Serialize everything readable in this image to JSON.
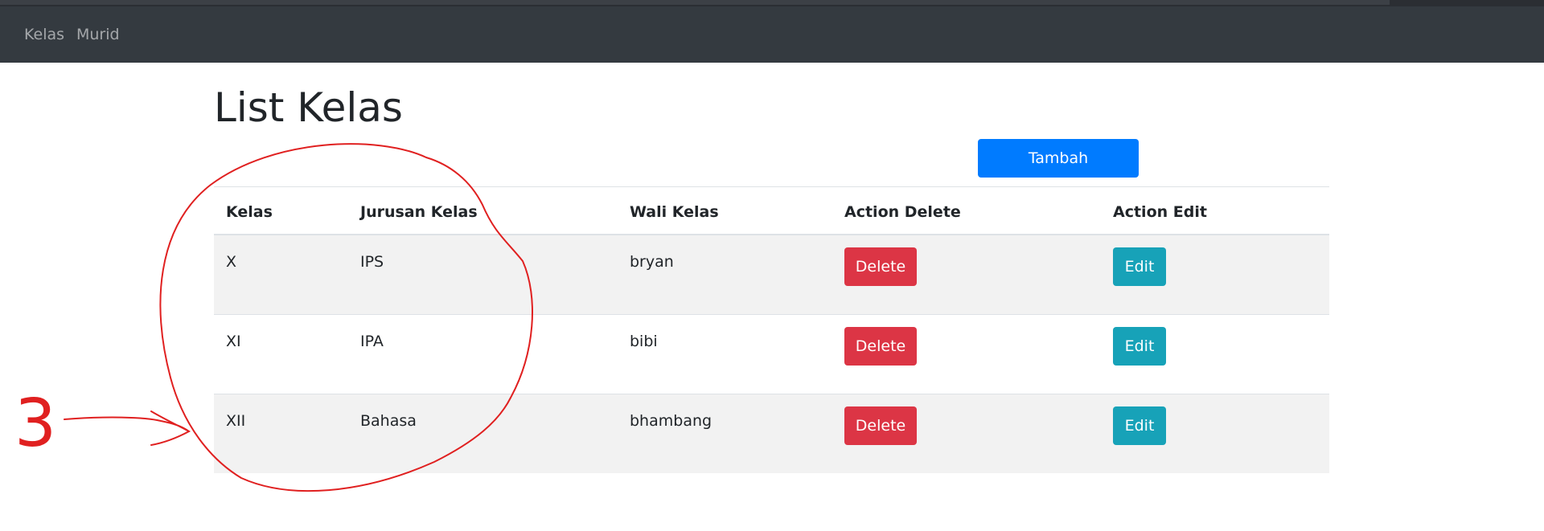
{
  "nav": {
    "items": [
      {
        "label": "Kelas"
      },
      {
        "label": "Murid"
      }
    ]
  },
  "page": {
    "title": "List Kelas",
    "add_button": "Tambah"
  },
  "table": {
    "headers": [
      "Kelas",
      "Jurusan Kelas",
      "Wali Kelas",
      "Action Delete",
      "Action Edit"
    ],
    "rows": [
      {
        "kelas": "X",
        "jurusan": "IPS",
        "wali": "bryan",
        "delete_label": "Delete",
        "edit_label": "Edit"
      },
      {
        "kelas": "XI",
        "jurusan": "IPA",
        "wali": "bibi",
        "delete_label": "Delete",
        "edit_label": "Edit"
      },
      {
        "kelas": "XII",
        "jurusan": "Bahasa",
        "wali": "bhambang",
        "delete_label": "Delete",
        "edit_label": "Edit"
      }
    ]
  },
  "annotation": {
    "number": "3",
    "color": "#e02020"
  },
  "colors": {
    "navbar": "#343a40",
    "primary": "#007bff",
    "danger": "#dc3545",
    "info": "#17a2b8",
    "stripe": "#f2f2f2"
  }
}
